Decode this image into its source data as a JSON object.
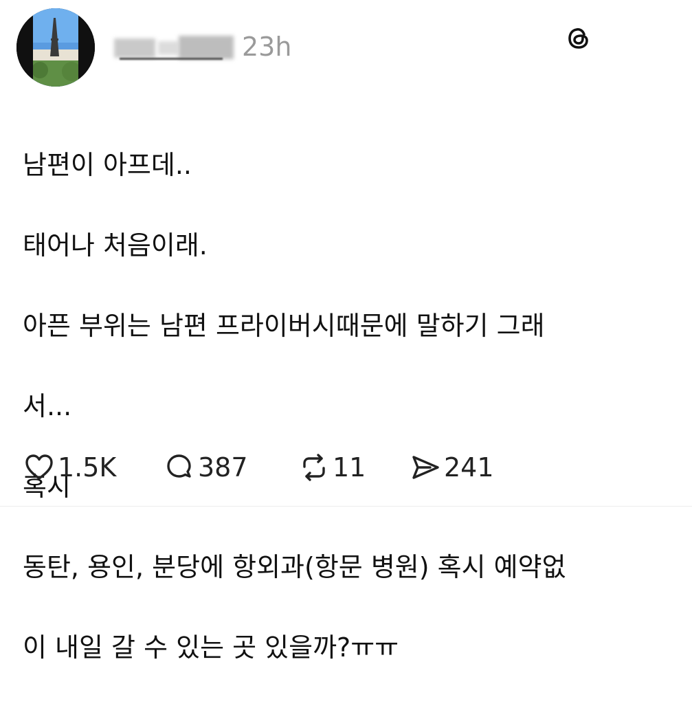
{
  "post": {
    "username": "",
    "timestamp": "23h",
    "lines": [
      "남편이 아프데..",
      "태어나 처음이래.",
      "아픈 부위는 남편 프라이버시때문에 말하기 그래",
      "서...",
      "혹시",
      "동탄, 용인, 분당에 항외과(항문 병원) 혹시 예약없",
      "이 내일 갈 수 있는 곳 있을까?ㅠㅠ"
    ],
    "actions": {
      "likes": "1.5K",
      "replies": "387",
      "reposts": "11",
      "shares": "241"
    }
  },
  "icons": {
    "logo": "threads-logo-icon",
    "like": "heart-icon",
    "reply": "speech-bubble-icon",
    "repost": "repost-icon",
    "share": "send-icon"
  }
}
